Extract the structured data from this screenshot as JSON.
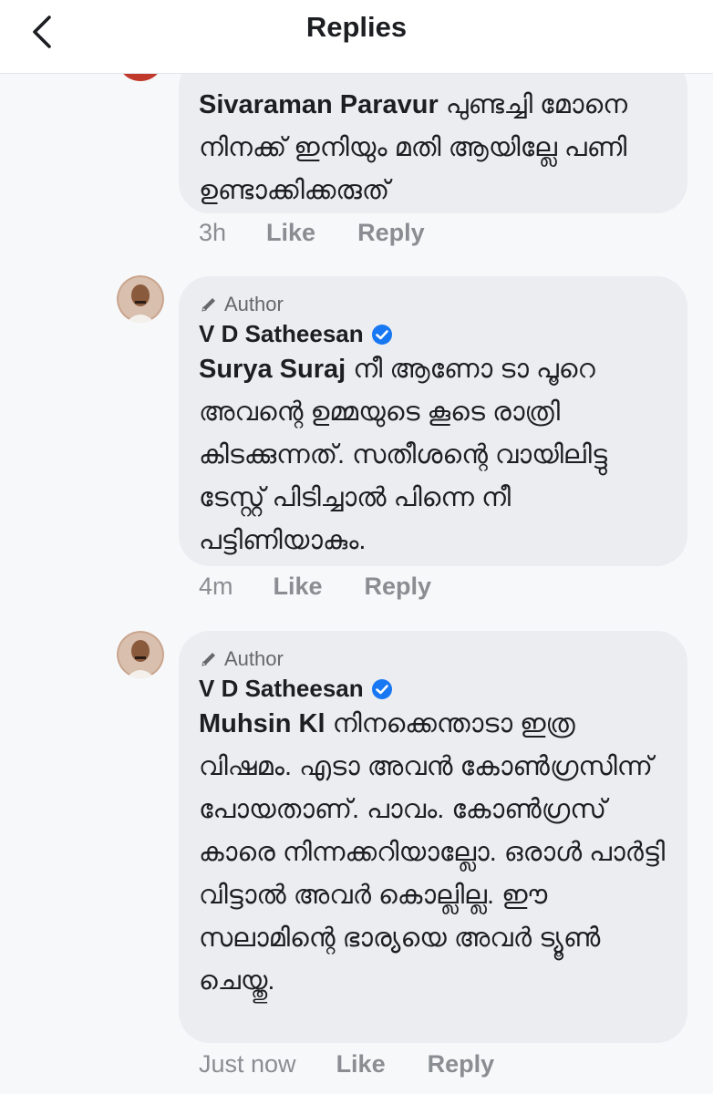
{
  "header": {
    "title": "Replies",
    "back_icon": "chevron-left-icon"
  },
  "colors": {
    "bubble": "#ebedf1",
    "verified": "#1877f2",
    "meta_text": "#8a8d91",
    "author_badge": "#65676b"
  },
  "comments": [
    {
      "author_name": "Sivaraman Paravur",
      "text": "പുണ്ടച്ചി മോനെ നിനക്ക് ഇനിയും മതി ആയില്ലേ പണി ഉണ്ടാക്കിക്കരുത്",
      "time": "3h",
      "like_label": "Like",
      "reply_label": "Reply"
    },
    {
      "author_badge": "Author",
      "author_name": "V D Satheesan",
      "verified": true,
      "mention": "Surya Suraj",
      "text": "നീ ആണോ ടാ പൂറെ അവന്റെ ഉമ്മയുടെ കൂടെ രാത്രി കിടക്കുന്നത്. സതീശന്റെ വായിലിട്ടു ടേസ്റ്റ് പിടിച്ചാൽ പിന്നെ നീ പട്ടിണിയാകും.",
      "time": "4m",
      "like_label": "Like",
      "reply_label": "Reply"
    },
    {
      "author_badge": "Author",
      "author_name": "V D Satheesan",
      "verified": true,
      "mention": "Muhsin Kl",
      "text": "നിനക്കെന്താടാ ഇത്ര വിഷമം. എടാ അവൻ കോൺഗ്രസിന്ന് പോയതാണ്. പാവം. കോൺഗ്രസ് കാരെ നിന്നക്കറിയാല്ലോ. ഒരാൾ പാർട്ടി വിട്ടാൽ അവർ കൊല്ലില്ല. ഈ സലാമിന്റെ ഭാര്യയെ അവർ ട്യൂൺ ചെയ്തു.",
      "time": "Just now",
      "like_label": "Like",
      "reply_label": "Reply"
    }
  ]
}
